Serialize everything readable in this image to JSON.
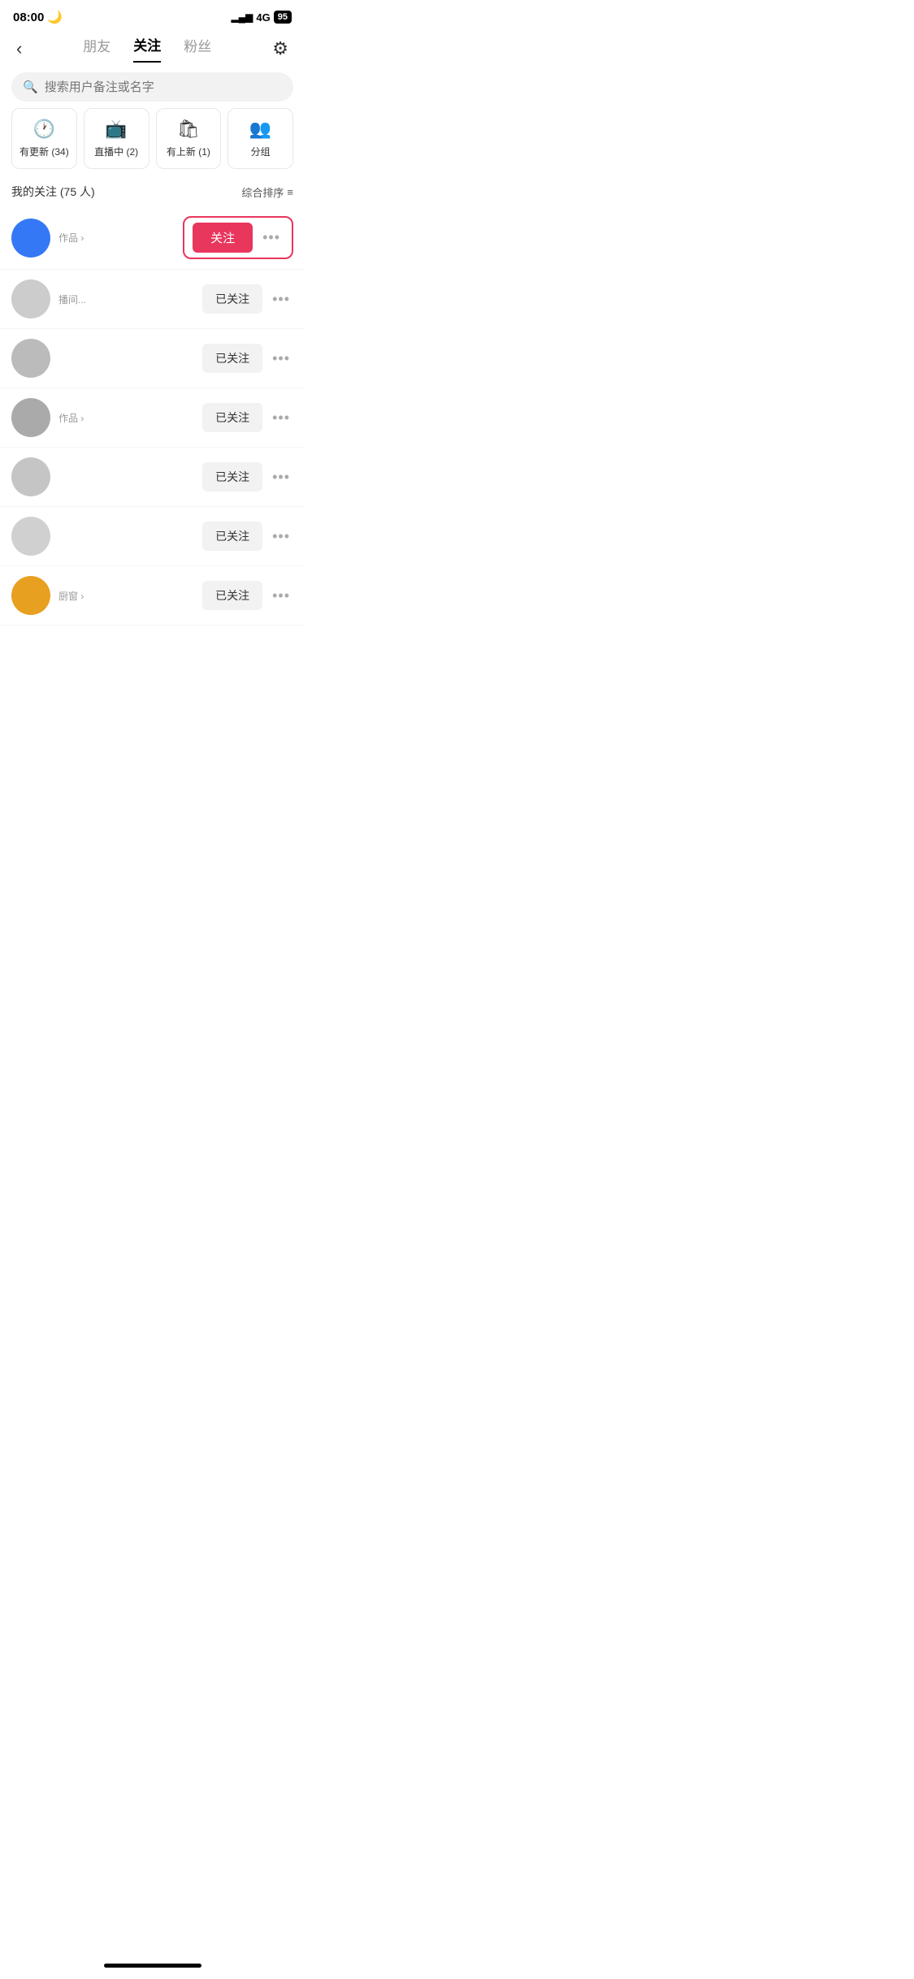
{
  "statusBar": {
    "time": "08:00",
    "moonIcon": "🌙",
    "network": "4G",
    "batteryPercent": "95"
  },
  "nav": {
    "backIcon": "‹",
    "tabs": [
      {
        "label": "朋友",
        "active": false
      },
      {
        "label": "关注",
        "active": true
      },
      {
        "label": "粉丝",
        "active": false
      }
    ],
    "settingsIcon": "⚙"
  },
  "search": {
    "placeholder": "搜索用户备注或名字"
  },
  "filterCards": [
    {
      "icon": "🕐",
      "label": "有更新 (34)"
    },
    {
      "icon": "📺",
      "label": "直播中 (2)"
    },
    {
      "icon": "🛍",
      "label": "有上新 (1)"
    },
    {
      "icon": "👥",
      "label": "分组"
    }
  ],
  "followHeader": {
    "countText": "我的关注 (75 人)",
    "sortText": "综合排序",
    "sortIcon": "≡"
  },
  "users": [
    {
      "id": 1,
      "name": "",
      "desc": "作品 ›",
      "avatarColor": "#3478f6",
      "buttonType": "follow",
      "buttonLabel": "关注",
      "highlighted": true
    },
    {
      "id": 2,
      "name": "",
      "desc": "播间...",
      "avatarColor": "#ccc",
      "buttonType": "following",
      "buttonLabel": "已关注",
      "highlighted": false
    },
    {
      "id": 3,
      "name": "",
      "desc": "",
      "avatarColor": "#bbb",
      "buttonType": "following",
      "buttonLabel": "已关注",
      "highlighted": false
    },
    {
      "id": 4,
      "name": "",
      "desc": "作品 ›",
      "avatarColor": "#aaa",
      "buttonType": "following",
      "buttonLabel": "已关注",
      "highlighted": false
    },
    {
      "id": 5,
      "name": "",
      "desc": "",
      "avatarColor": "#c5c5c5",
      "buttonType": "following",
      "buttonLabel": "已关注",
      "highlighted": false
    },
    {
      "id": 6,
      "name": "",
      "desc": "",
      "avatarColor": "#d0d0d0",
      "buttonType": "following",
      "buttonLabel": "已关注",
      "highlighted": false
    },
    {
      "id": 7,
      "name": "",
      "desc": "厨窗 ›",
      "avatarColor": "#e8a020",
      "buttonType": "following",
      "buttonLabel": "已关注",
      "highlighted": false
    }
  ],
  "dotsIcon": "•••"
}
